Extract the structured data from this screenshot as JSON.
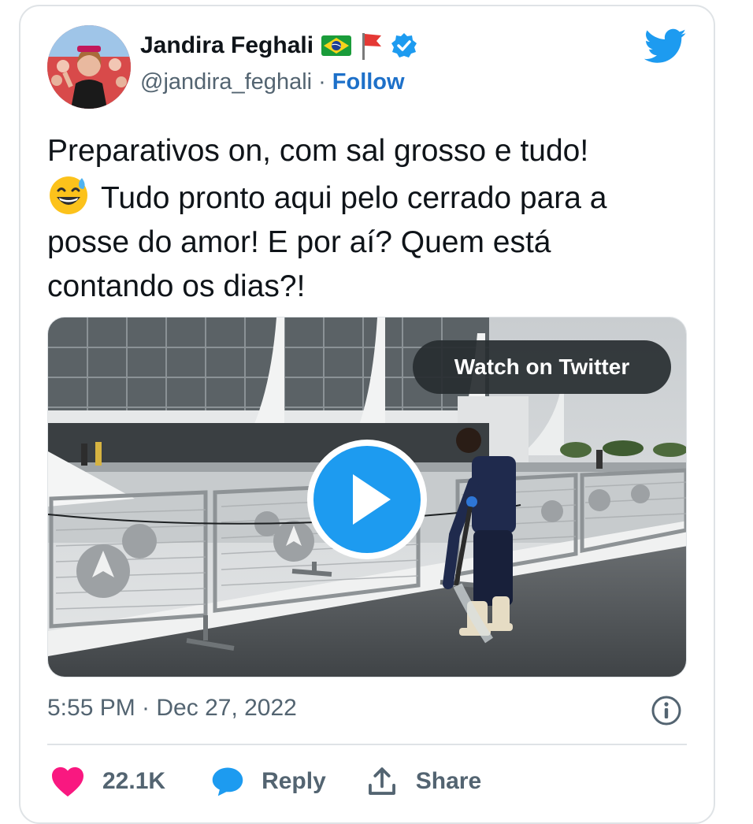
{
  "author": {
    "name": "Jandira Feghali",
    "handle": "@jandira_feghali",
    "separator": "·",
    "follow_label": "Follow",
    "flags": [
      "brazil-flag-icon",
      "red-flag-icon"
    ],
    "verified": true
  },
  "tweet": {
    "line1": "Preparativos on, com sal grosso e tudo!",
    "line2": "Tudo pronto aqui pelo cerrado para a",
    "line3": "posse do amor! E por aí? Quem está",
    "line4": "contando os dias?!",
    "emoji": "sweat-smile-emoji"
  },
  "media": {
    "watch_label": "Watch on Twitter",
    "type": "video"
  },
  "meta": {
    "timestamp": "5:55 PM · Dec 27, 2022"
  },
  "actions": {
    "likes": "22.1K",
    "reply_label": "Reply",
    "share_label": "Share"
  },
  "colors": {
    "accent": "#1d9bf0",
    "follow": "#1d70c9",
    "heart": "#f91880",
    "muted": "#536471"
  }
}
